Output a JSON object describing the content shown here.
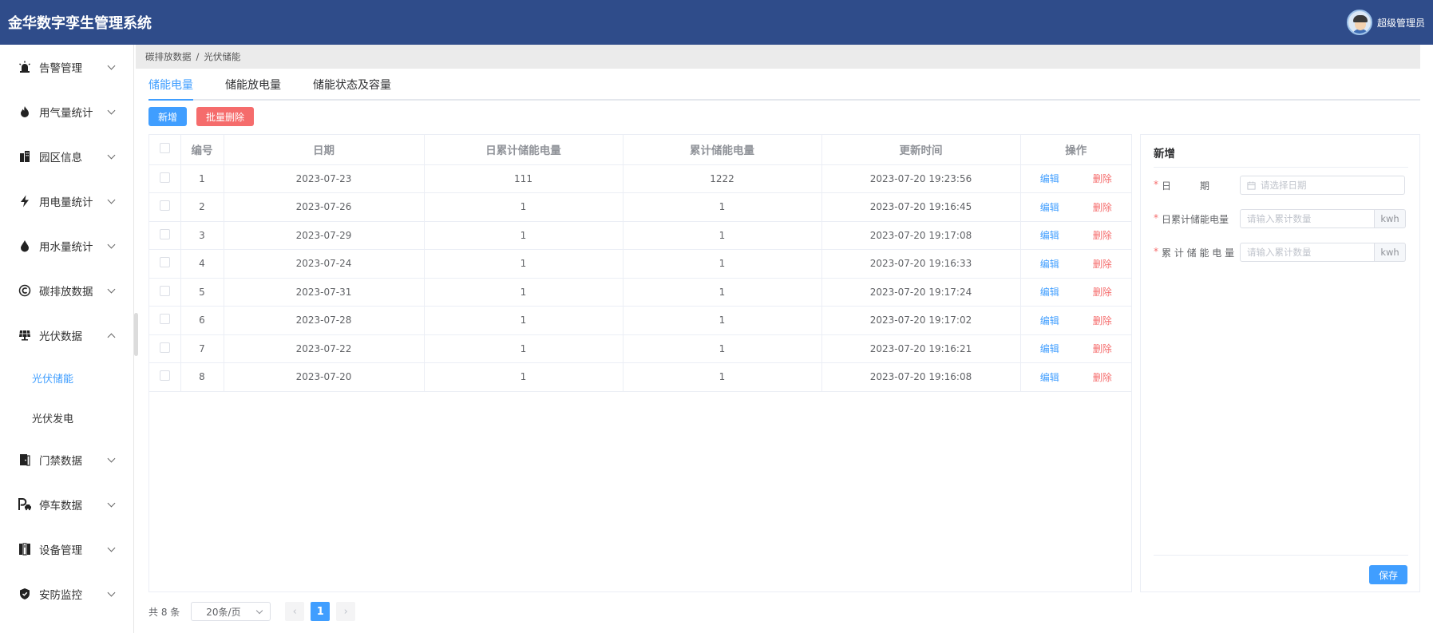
{
  "header": {
    "title": "金华数字孪生管理系统",
    "username": "超级管理员"
  },
  "sidebar": {
    "items": [
      {
        "label": "告警管理",
        "icon": "alarm-icon"
      },
      {
        "label": "用气量统计",
        "icon": "flame-icon"
      },
      {
        "label": "园区信息",
        "icon": "building-icon"
      },
      {
        "label": "用电量统计",
        "icon": "lightning-icon"
      },
      {
        "label": "用水量统计",
        "icon": "water-drop-icon"
      },
      {
        "label": "碳排放数据",
        "icon": "carbon-icon"
      },
      {
        "label": "光伏数据",
        "icon": "solar-panel-icon",
        "expanded": true,
        "children": [
          {
            "label": "光伏储能",
            "active": true
          },
          {
            "label": "光伏发电"
          }
        ]
      },
      {
        "label": "门禁数据",
        "icon": "door-icon"
      },
      {
        "label": "停车数据",
        "icon": "parking-icon"
      },
      {
        "label": "设备管理",
        "icon": "device-icon"
      },
      {
        "label": "安防监控",
        "icon": "shield-icon"
      }
    ]
  },
  "breadcrumb": {
    "parent": "碳排放数据",
    "separator": "/",
    "current": "光伏储能"
  },
  "tabs": [
    "储能电量",
    "储能放电量",
    "储能状态及容量"
  ],
  "toolbar": {
    "add_label": "新增",
    "batch_delete_label": "批量删除"
  },
  "table": {
    "headers": [
      "编号",
      "日期",
      "日累计储能电量",
      "累计储能电量",
      "更新时间",
      "操作"
    ],
    "edit_label": "编辑",
    "delete_label": "删除",
    "rows": [
      {
        "id": "1",
        "date": "2023-07-23",
        "daily": "111",
        "total": "1222",
        "updated": "2023-07-20 19:23:56"
      },
      {
        "id": "2",
        "date": "2023-07-26",
        "daily": "1",
        "total": "1",
        "updated": "2023-07-20 19:16:45"
      },
      {
        "id": "3",
        "date": "2023-07-29",
        "daily": "1",
        "total": "1",
        "updated": "2023-07-20 19:17:08"
      },
      {
        "id": "4",
        "date": "2023-07-24",
        "daily": "1",
        "total": "1",
        "updated": "2023-07-20 19:16:33"
      },
      {
        "id": "5",
        "date": "2023-07-31",
        "daily": "1",
        "total": "1",
        "updated": "2023-07-20 19:17:24"
      },
      {
        "id": "6",
        "date": "2023-07-28",
        "daily": "1",
        "total": "1",
        "updated": "2023-07-20 19:17:02"
      },
      {
        "id": "7",
        "date": "2023-07-22",
        "daily": "1",
        "total": "1",
        "updated": "2023-07-20 19:16:21"
      },
      {
        "id": "8",
        "date": "2023-07-20",
        "daily": "1",
        "total": "1",
        "updated": "2023-07-20 19:16:08"
      }
    ]
  },
  "form": {
    "title": "新增",
    "date_label": "日　　　期",
    "date_placeholder": "请选择日期",
    "daily_label": "日累计储能电量",
    "daily_placeholder": "请输入累计数量",
    "total_label": "累 计 储 能 电 量",
    "total_placeholder": "请输入累计数量",
    "unit": "kwh",
    "save_label": "保存"
  },
  "pagination": {
    "total_text": "共 8 条",
    "page_size": "20条/页",
    "current_page": "1",
    "prev": "‹",
    "next": "›"
  },
  "colors": {
    "header_bg": "#2f4c8a",
    "primary": "#409eff",
    "danger": "#f56c6c"
  }
}
